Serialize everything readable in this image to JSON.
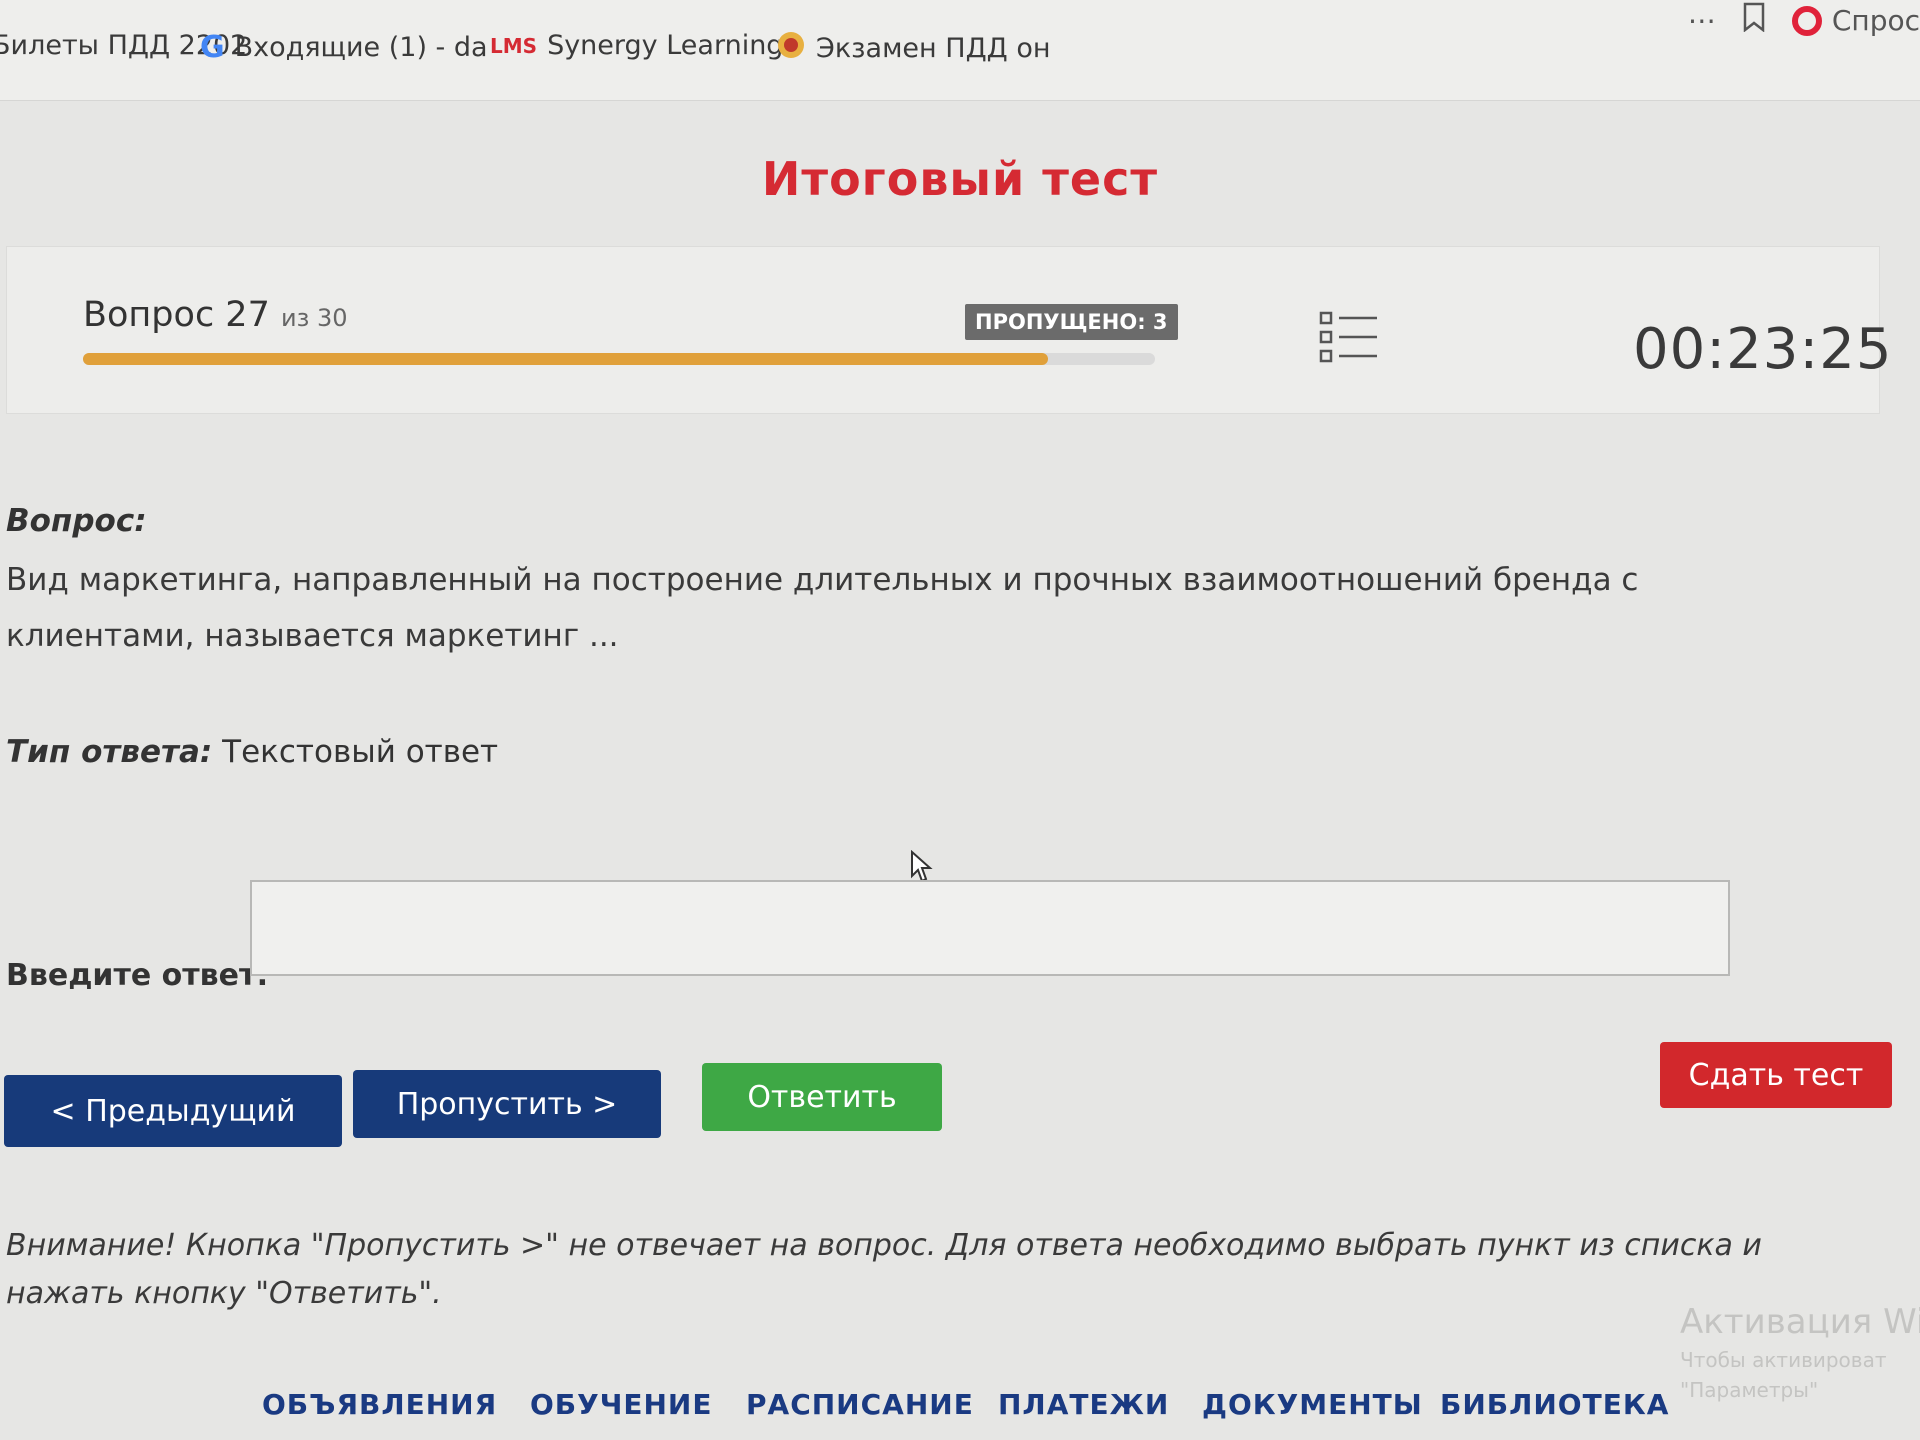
{
  "browser": {
    "bookmarks": [
      {
        "label": "Билеты ПДД 2202",
        "icon": "document-icon"
      },
      {
        "label": "Входящие (1) - da",
        "icon": "google-g-icon"
      },
      {
        "label": "Synergy Learning",
        "icon": "lms-logo-icon",
        "prefix": "LMS"
      },
      {
        "label": "Экзамен ПДД он",
        "icon": "emblem-icon"
      }
    ],
    "right_label": "Спрос"
  },
  "page": {
    "title": "Итоговый тест"
  },
  "status": {
    "question_label": "Вопрос 27",
    "question_of": "из 30",
    "current": 27,
    "total": 30,
    "progress_fraction": 0.9,
    "skipped_badge": "ПРОПУЩЕНО: 3",
    "timer": "00:23:25"
  },
  "question": {
    "label": "Вопрос:",
    "text": "Вид маркетинга, направленный на построение длительных и прочных взаимоотношений бренда с клиентами, называется маркетинг ..."
  },
  "answer_type": {
    "label": "Тип ответа:",
    "value": "Текстовый ответ"
  },
  "answer": {
    "label": "Введите ответ:",
    "value": ""
  },
  "buttons": {
    "prev": "< Предыдущий",
    "skip": "Пропустить >",
    "answer": "Ответить",
    "submit": "Сдать тест"
  },
  "notice": "Внимание! Кнопка \"Пропустить >\" не отвечает на вопрос. Для ответа необходимо выбрать пункт из списка и нажать кнопку \"Ответить\".",
  "watermark": {
    "title": "Активация Wi",
    "line1": "Чтобы активироват",
    "line2": "\"Параметры\""
  },
  "nav": [
    "ОБЪЯВЛЕНИЯ",
    "ОБУЧЕНИЕ",
    "РАСПИСАНИЕ",
    "ПЛАТЕЖИ",
    "ДОКУМЕНТЫ",
    "БИБЛИОТЕКА"
  ],
  "colors": {
    "title_red": "#d52a33",
    "primary_blue": "#173a7a",
    "answer_green": "#3ea845",
    "submit_red": "#d2282c",
    "progress_orange": "#e0a03a"
  }
}
